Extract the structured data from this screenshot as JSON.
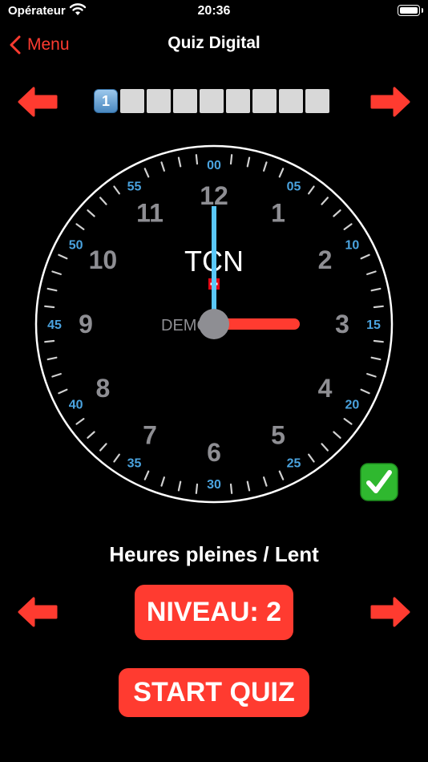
{
  "status_bar": {
    "carrier": "Opérateur",
    "time": "20:36"
  },
  "nav": {
    "back_label": "Menu",
    "title": "Quiz Digital"
  },
  "progress": {
    "current": "1",
    "total_cells": 9,
    "current_index": 1
  },
  "clock": {
    "brand": "TCN",
    "demo_label": "DEMO",
    "hour_numerals": [
      "12",
      "1",
      "2",
      "3",
      "4",
      "5",
      "6",
      "7",
      "8",
      "9",
      "10",
      "11"
    ],
    "minute_labels": [
      "00",
      "05",
      "10",
      "15",
      "20",
      "25",
      "30",
      "35",
      "40",
      "45",
      "50",
      "55"
    ],
    "time_shown": {
      "hour": 3,
      "minute": 0
    }
  },
  "result_icon": "check-mark-icon",
  "mode_label": "Heures pleines / Lent",
  "level_button": "NIVEAU: 2",
  "start_button": "START QUIZ",
  "colors": {
    "accent": "#ff3b30",
    "minute_hand": "#5ac8fa",
    "hour_hand": "#ff3b30",
    "minute_label": "#4aa3df",
    "numeral": "#8e8e93"
  }
}
